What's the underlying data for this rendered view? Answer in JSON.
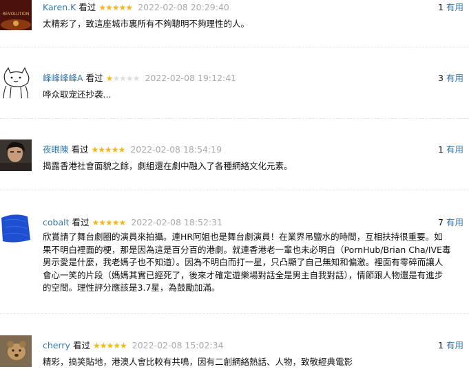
{
  "reviews": [
    {
      "user": "Karen.K",
      "seen_label": "看过",
      "rating": 5,
      "time": "2022-02-08 20:29:40",
      "useful_count": "1",
      "useful_label": "有用",
      "avatar_text": "REVOLUTION",
      "content": "太精彩了，致這座城市裏所有不夠聰明不夠理性的人。"
    },
    {
      "user": "峰峰峰峰A",
      "seen_label": "看过",
      "rating": 1,
      "time": "2022-02-08 19:12:41",
      "useful_count": "3",
      "useful_label": "有用",
      "content": "哗众取宠还抄袭..."
    },
    {
      "user": "夜眼陳",
      "seen_label": "看过",
      "rating": 5,
      "time": "2022-02-08 18:54:19",
      "useful_count": "1",
      "useful_label": "有用",
      "content": "揭露香港社會面貌之餘，劇組還在劇中融入了各種網絡文化元素。"
    },
    {
      "user": "cobalt",
      "seen_label": "看过",
      "rating": 5,
      "time": "2022-02-08 18:52:31",
      "useful_count": "7",
      "useful_label": "有用",
      "content_lines": [
        "欣賞請了舞台劇圈的演員來拍攝。連HR阿姐也是舞台劇演員！在業界吊鹽水的時間，互相扶持很重要。如",
        "果不明白裡面的梗，那是因為這是百分百的港劇。就連香港老一輩也未必明白（PornHub/Brian Cha/IVE毒",
        "男示愛是什麼，我老媽子也不知道）。因為不明白而打一星，只凸顯了自己無知和偏激。裡面有零碎而讓人",
        "會心一笑的片段（媽媽其實已經死了，後來才確定遊樂場對話全是男主自我對話），情節跟人物還是有進步",
        "的空間。理性評分應該是3.7星，為鼓勵加滿。"
      ]
    },
    {
      "user": "cherry",
      "seen_label": "看过",
      "rating": 5,
      "time": "2022-02-08 15:02:34",
      "useful_count": "1",
      "useful_label": "有用",
      "content": "精彩，搞笑貼地，港澳人會比較有共鳴，因有二創網絡熱話、人物，致敬經典電影"
    }
  ]
}
